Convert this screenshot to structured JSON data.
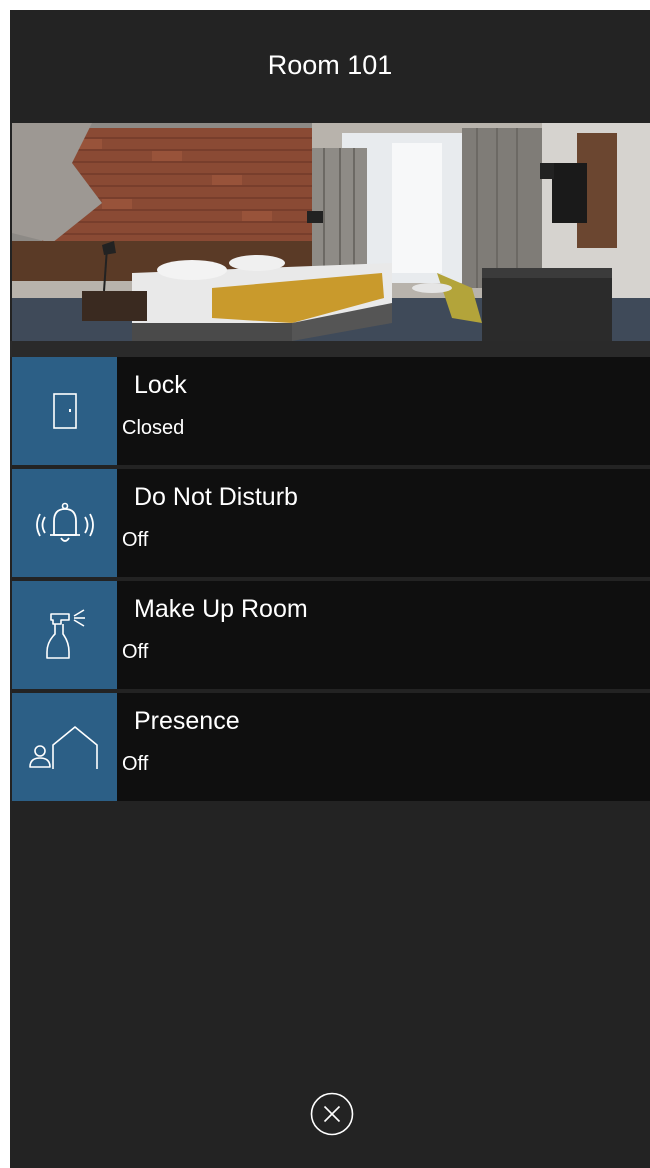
{
  "header": {
    "title": "Room 101"
  },
  "hero": {
    "image": "hotel-room-photo"
  },
  "controls": [
    {
      "label": "Lock",
      "status": "Closed",
      "icon": "door-icon"
    },
    {
      "label": "Do Not Disturb",
      "status": "Off",
      "icon": "ringing-bell-icon"
    },
    {
      "label": "Make Up Room",
      "status": "Off",
      "icon": "spray-bottle-icon"
    },
    {
      "label": "Presence",
      "status": "Off",
      "icon": "person-house-icon"
    }
  ],
  "footer": {
    "close_icon": "close-circle-icon"
  },
  "colors": {
    "background": "#232323",
    "row_background": "#0f0f0f",
    "tile_accent": "#2c5f86",
    "text": "#ffffff"
  }
}
